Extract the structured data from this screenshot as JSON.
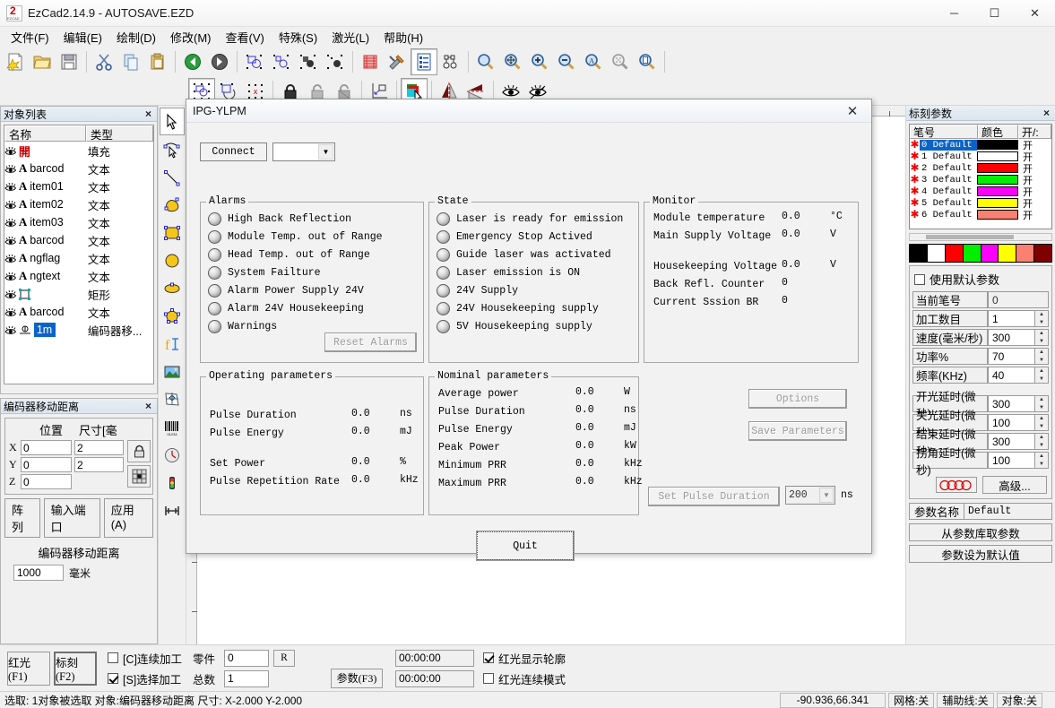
{
  "window": {
    "title": "EzCad2.14.9 - AUTOSAVE.EZD",
    "minimize": "─",
    "maximize": "☐",
    "close": "✕"
  },
  "menu": [
    "文件(F)",
    "编辑(E)",
    "绘制(D)",
    "修改(M)",
    "查看(V)",
    "特殊(S)",
    "激光(L)",
    "帮助(H)"
  ],
  "toolbar_main": [
    {
      "name": "new-file-icon"
    },
    {
      "name": "open-file-icon"
    },
    {
      "name": "save-file-icon"
    },
    {
      "name": "cut-icon"
    },
    {
      "name": "copy-icon"
    },
    {
      "name": "paste-icon"
    },
    {
      "name": "undo-icon"
    },
    {
      "name": "redo-icon"
    },
    {
      "name": "group-icon"
    },
    {
      "name": "ungroup-icon"
    },
    {
      "name": "combine-icon"
    },
    {
      "name": "uncombine-icon"
    },
    {
      "name": "hatch-icon"
    },
    {
      "name": "tools-icon"
    },
    {
      "name": "parameter-list-icon"
    },
    {
      "name": "node-edit-icon"
    }
  ],
  "toolbar_zoom": [
    {
      "name": "zoom-select-icon"
    },
    {
      "name": "zoom-pan-icon"
    },
    {
      "name": "zoom-in-icon"
    },
    {
      "name": "zoom-out-icon"
    },
    {
      "name": "zoom-all-icon"
    },
    {
      "name": "zoom-extent-icon"
    },
    {
      "name": "zoom-page-icon"
    }
  ],
  "toolbar_second": [
    {
      "name": "select-object-icon"
    },
    {
      "name": "rotate-object-icon"
    },
    {
      "name": "delete-node-icon"
    },
    {
      "name": "lock-icon"
    },
    {
      "name": "unlock-icon"
    },
    {
      "name": "unlock-all-icon"
    },
    {
      "name": "align-origin-icon"
    },
    {
      "name": "color-layer-icon"
    },
    {
      "name": "mirror-horizontal-icon"
    },
    {
      "name": "mirror-vertical-icon"
    },
    {
      "name": "show-all-icon"
    },
    {
      "name": "hide-icon"
    }
  ],
  "vertical_toolbar": [
    {
      "name": "pointer-tool"
    },
    {
      "name": "node-edit-tool"
    },
    {
      "name": "line-tool"
    },
    {
      "name": "curve-tool"
    },
    {
      "name": "rectangle-tool"
    },
    {
      "name": "ellipse-tool"
    },
    {
      "name": "oval-tool"
    },
    {
      "name": "polygon-tool"
    },
    {
      "name": "text-tool"
    },
    {
      "name": "image-tool"
    },
    {
      "name": "vector-file-tool"
    },
    {
      "name": "barcode-tool"
    },
    {
      "name": "timer-tool"
    },
    {
      "name": "signal-tool"
    },
    {
      "name": "encoder-tool"
    }
  ],
  "object_list": {
    "title": "对象列表",
    "close": "×",
    "columns": [
      "名称",
      "类型"
    ],
    "rows": [
      {
        "icon": "fill-icon",
        "name": "",
        "type": "填充",
        "selected": false
      },
      {
        "icon": "text-icon",
        "name": "barcod",
        "type": "文本",
        "selected": false
      },
      {
        "icon": "text-icon",
        "name": "item01",
        "type": "文本",
        "selected": false
      },
      {
        "icon": "text-icon",
        "name": "item02",
        "type": "文本",
        "selected": false
      },
      {
        "icon": "text-icon",
        "name": "item03",
        "type": "文本",
        "selected": false
      },
      {
        "icon": "text-icon",
        "name": "barcod",
        "type": "文本",
        "selected": false
      },
      {
        "icon": "text-icon",
        "name": "ngflag",
        "type": "文本",
        "selected": false
      },
      {
        "icon": "text-icon",
        "name": "ngtext",
        "type": "文本",
        "selected": false
      },
      {
        "icon": "rect-icon",
        "name": "",
        "type": "矩形",
        "selected": false
      },
      {
        "icon": "text-icon",
        "name": "barcod",
        "type": "文本",
        "selected": false
      },
      {
        "icon": "encoder-icon",
        "name": "1m",
        "type": "编码器移...",
        "selected": true
      }
    ]
  },
  "position_panel": {
    "title": "编码器移动距离",
    "close": "×",
    "header_position": "位置",
    "header_size": "尺寸[毫",
    "axes": [
      {
        "label": "X",
        "position": "0",
        "size": "2"
      },
      {
        "label": "Y",
        "position": "0",
        "size": "2"
      },
      {
        "label": "Z",
        "position": "0",
        "size": ""
      }
    ],
    "lock_icon": "padlock-icon",
    "anchor_icon": "anchor-grid-icon",
    "buttons": [
      "阵列",
      "输入端口",
      "应用(A)"
    ],
    "encoder_label": "编码器移动距离",
    "encoder_value": "1000",
    "encoder_unit": "毫米"
  },
  "mark_params": {
    "title": "标刻参数",
    "close": "×",
    "columns": [
      "笔号",
      "颜色",
      "开/:"
    ],
    "pens": [
      {
        "index": "0 Default",
        "color": "#000000",
        "on": "开",
        "selected": true
      },
      {
        "index": "1 Default",
        "color": "#ffffff",
        "on": "开",
        "selected": false
      },
      {
        "index": "2 Default",
        "color": "#ff0000",
        "on": "开",
        "selected": false
      },
      {
        "index": "3 Default",
        "color": "#00ee00",
        "on": "开",
        "selected": false
      },
      {
        "index": "4 Default",
        "color": "#ff00ff",
        "on": "开",
        "selected": false
      },
      {
        "index": "5 Default",
        "color": "#ffff00",
        "on": "开",
        "selected": false
      },
      {
        "index": "6 Default",
        "color": "#fa8072",
        "on": "开",
        "selected": false
      }
    ],
    "color_strip": [
      "#000000",
      "#ffffff",
      "#ff0000",
      "#00ee00",
      "#ff00ff",
      "#ffff00",
      "#fa8072",
      "#800000"
    ],
    "use_default_label": "使用默认参数",
    "use_default_checked": false,
    "fields": [
      {
        "label": "当前笔号",
        "value": "0",
        "spinner": false,
        "readonly": true
      },
      {
        "label": "加工数目",
        "value": "1",
        "spinner": true,
        "readonly": false
      },
      {
        "label": "速度(毫米/秒)",
        "value": "300",
        "spinner": true,
        "readonly": false
      },
      {
        "label": "功率%",
        "value": "70",
        "spinner": true,
        "readonly": false
      },
      {
        "label": "频率(KHz)",
        "value": "40",
        "spinner": true,
        "readonly": false
      }
    ],
    "fields2": [
      {
        "label": "开光延时(微秒)",
        "value": "300",
        "spinner": true
      },
      {
        "label": "关光延时(微秒)",
        "value": "100",
        "spinner": true
      },
      {
        "label": "结束延时(微秒)",
        "value": "300",
        "spinner": true
      },
      {
        "label": "拐角延时(微秒)",
        "value": "100",
        "spinner": true
      }
    ],
    "audi_icon": "audi-rings-icon",
    "advanced_button": "高级...",
    "param_name_label": "参数名称",
    "param_name_value": "Default",
    "load_button": "从参数库取参数",
    "default_button": "参数设为默认值"
  },
  "dialog": {
    "title": "IPG-YLPM",
    "close": "✕",
    "connect_button": "Connect",
    "combo_value": "",
    "combo_arrow": "▼",
    "alarms": {
      "caption": "Alarms",
      "items": [
        "High Back Reflection",
        "Module Temp. out of Range",
        "Head Temp. out of Range",
        "System Failture",
        "Alarm Power Supply 24V",
        "Alarm 24V Housekeeping",
        "Warnings"
      ],
      "reset_button": "Reset Alarms"
    },
    "state": {
      "caption": "State",
      "items": [
        "Laser is ready for emission",
        "Emergency Stop Actived",
        "Guide laser was activated",
        "Laser emission is ON",
        "24V Supply",
        "24V Housekeeping supply",
        "5V Housekeeping supply"
      ]
    },
    "monitor": {
      "caption": "Monitor",
      "rows": [
        {
          "name": "Module temperature",
          "value": "0.0",
          "unit": "°C"
        },
        {
          "name": "Main Supply Voltage",
          "value": "0.0",
          "unit": "V"
        },
        {
          "name": "Housekeeping Voltage",
          "value": "0.0",
          "unit": "V"
        },
        {
          "name": "Back Refl. Counter",
          "value": "0",
          "unit": ""
        },
        {
          "name": "Current Sssion BR",
          "value": "0",
          "unit": ""
        }
      ]
    },
    "operating": {
      "caption": "Operating parameters",
      "rows": [
        {
          "name": "Pulse Duration",
          "value": "0.0",
          "unit": "ns"
        },
        {
          "name": "Pulse Energy",
          "value": "0.0",
          "unit": "mJ"
        },
        {
          "name": "Set Power",
          "value": "0.0",
          "unit": "%"
        },
        {
          "name": "Pulse Repetition Rate",
          "value": "0.0",
          "unit": "kHz"
        }
      ]
    },
    "nominal": {
      "caption": "Nominal parameters",
      "rows": [
        {
          "name": "Average power",
          "value": "0.0",
          "unit": "W"
        },
        {
          "name": "Pulse Duration",
          "value": "0.0",
          "unit": "ns"
        },
        {
          "name": "Pulse Energy",
          "value": "0.0",
          "unit": "mJ"
        },
        {
          "name": "Peak Power",
          "value": "0.0",
          "unit": "kW"
        },
        {
          "name": "Minimum PRR",
          "value": "0.0",
          "unit": "kHz"
        },
        {
          "name": "Maximum PRR",
          "value": "0.0",
          "unit": "kHz"
        }
      ]
    },
    "options_button": "Options",
    "save_params_button": "Save Parameters",
    "set_pulse_button": "Set Pulse Duration",
    "pulse_combo_value": "200",
    "pulse_combo_arrow": "▼",
    "pulse_unit": "ns",
    "quit_button": "Quit"
  },
  "bottom": {
    "red_light_button": "红光(F1)",
    "mark_button": "标刻(F2)",
    "continuous_label": "[C]连续加工",
    "continuous_checked": false,
    "select_label": "[S]选择加工",
    "select_checked": true,
    "parts_label": "零件",
    "total_label": "总数",
    "parts_value": "0",
    "total_value": "1",
    "r_button": "R",
    "param_button": "参数(F3)",
    "time1": "00:00:00",
    "time2": "00:00:00",
    "show_outline_label": "红光显示轮廓",
    "show_outline_checked": true,
    "continuous_mode_label": "红光连续模式",
    "continuous_mode_checked": false
  },
  "statusbar": {
    "message": "选取: 1对象被选取 对象:编码器移动距离 尺寸: X-2.000 Y-2.000",
    "coords": "-90.936,66.341",
    "grid": "网格:关",
    "guides": "辅助线:关",
    "object_snap": "对象:关"
  }
}
